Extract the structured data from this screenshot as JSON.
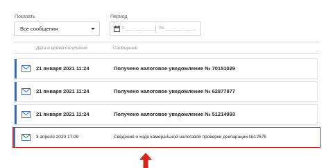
{
  "filters": {
    "show_label": "Показать",
    "show_value": "Все сообщения",
    "period_label": "Период",
    "period_from": "с ___.___.____",
    "period_to": "по ___.___.____"
  },
  "table": {
    "col_date": "Дата и время получения",
    "col_message": "Сообщение",
    "rows": [
      {
        "date": "21 января 2021 11:24",
        "message": "Получено налоговое уведомление № 70151029"
      },
      {
        "date": "21 января 2021 11:24",
        "message": "Получено налоговое уведомление № 62877977"
      },
      {
        "date": "21 января 2021 11:24",
        "message": "Получено налоговое уведомление № 51214993"
      },
      {
        "date": "3 апреля 2020 17:09",
        "message": "Сведения о ходе камеральной налоговой проверки декларации №12676"
      }
    ]
  },
  "colors": {
    "accent": "#3a6fb5",
    "highlight": "#b53232",
    "arrow": "#d9241e"
  },
  "icons": {
    "dropdown": "chevron-down-icon",
    "calendar": "calendar-icon",
    "message": "envelope-icon",
    "pointer": "arrow-up-icon"
  }
}
